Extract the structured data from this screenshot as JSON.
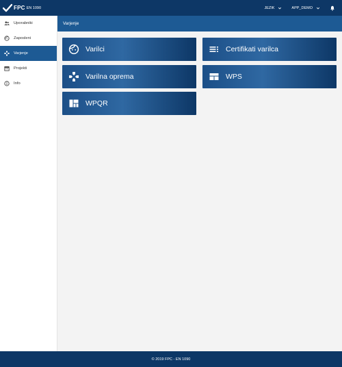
{
  "header": {
    "logo_text": "FPC",
    "logo_sub": "EN 1090",
    "language_label": "JEZIK",
    "user_label": "APP_DEMO"
  },
  "sidebar": {
    "items": [
      {
        "label": "Uporabniki",
        "icon": "users-icon"
      },
      {
        "label": "Zaposleni",
        "icon": "face-icon"
      },
      {
        "label": "Varjenje",
        "icon": "gamepad-icon",
        "active": true
      },
      {
        "label": "Projekti",
        "icon": "calendar-icon"
      },
      {
        "label": "Info",
        "icon": "info-icon"
      }
    ]
  },
  "content": {
    "title": "Varjenje",
    "tiles": [
      {
        "label": "Varilci",
        "icon": "face-icon"
      },
      {
        "label": "Certifikati varilca",
        "icon": "list-icon"
      },
      {
        "label": "Varilna oprema",
        "icon": "gamepad-icon"
      },
      {
        "label": "WPS",
        "icon": "web-icon"
      },
      {
        "label": "WPQR",
        "icon": "dashboard-icon"
      }
    ]
  },
  "footer": {
    "text": "© 2019 FPC - EN 1090"
  },
  "colors": {
    "navy": "#0d3766",
    "accent": "#1d5a94",
    "background": "#f3f3f3"
  }
}
